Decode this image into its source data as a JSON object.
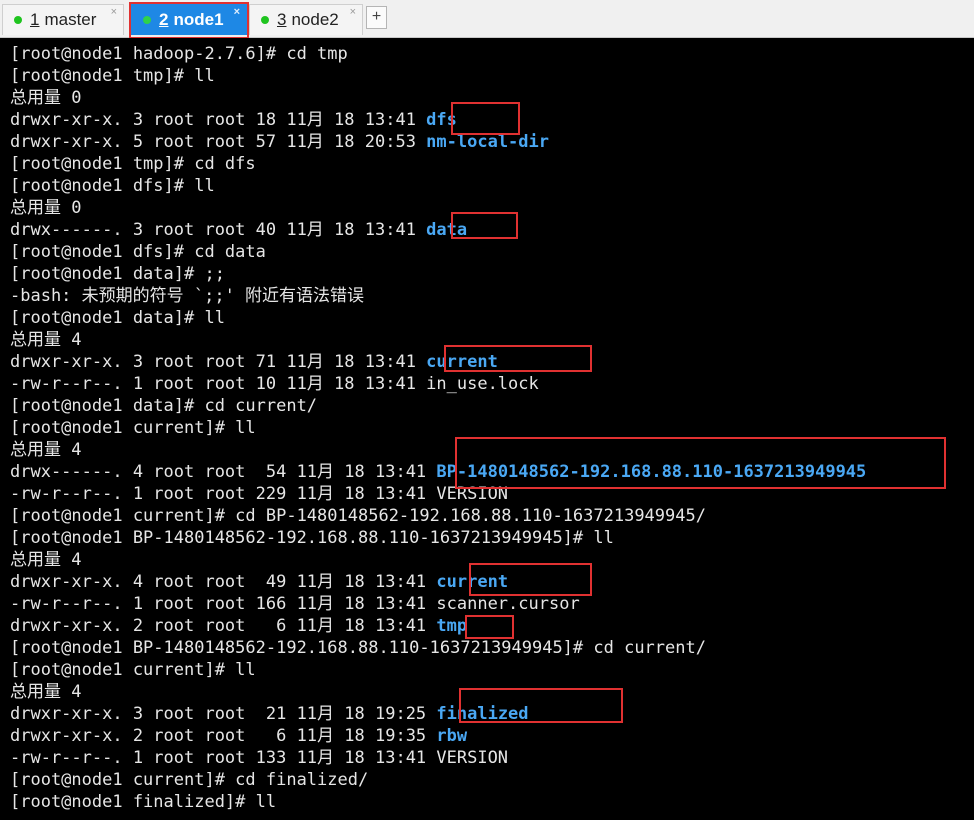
{
  "tabs": [
    {
      "number": "1",
      "name": "master",
      "active": false
    },
    {
      "number": "2",
      "name": "node1",
      "active": true
    },
    {
      "number": "3",
      "name": "node2",
      "active": false
    }
  ],
  "new_tab_symbol": "+",
  "close_symbol": "×",
  "colors": {
    "active_tab": "#1e88e5",
    "directory": "#4aa8f4",
    "highlight_box": "#e03131",
    "background": "#000000",
    "text": "#e6e6e6"
  },
  "terminal": {
    "lines": [
      {
        "text": "[root@node1 hadoop-2.7.6]# cd tmp"
      },
      {
        "text": "[root@node1 tmp]# ll"
      },
      {
        "text": "总用量 0"
      },
      {
        "text": "drwxr-xr-x. 3 root root 18 11月 18 13:41 ",
        "dir": "dfs"
      },
      {
        "text": "drwxr-xr-x. 5 root root 57 11月 18 20:53 ",
        "dir": "nm-local-dir"
      },
      {
        "text": "[root@node1 tmp]# cd dfs"
      },
      {
        "text": "[root@node1 dfs]# ll"
      },
      {
        "text": "总用量 0"
      },
      {
        "text": "drwx------. 3 root root 40 11月 18 13:41 ",
        "dir": "data"
      },
      {
        "text": "[root@node1 dfs]# cd data"
      },
      {
        "text": "[root@node1 data]# ;;"
      },
      {
        "text": "-bash: 未预期的符号 `;;' 附近有语法错误"
      },
      {
        "text": "[root@node1 data]# ll"
      },
      {
        "text": "总用量 4"
      },
      {
        "text": "drwxr-xr-x. 3 root root 71 11月 18 13:41 ",
        "dir": "current"
      },
      {
        "text": "-rw-r--r--. 1 root root 10 11月 18 13:41 in_use.lock"
      },
      {
        "text": "[root@node1 data]# cd current/"
      },
      {
        "text": "[root@node1 current]# ll"
      },
      {
        "text": "总用量 4"
      },
      {
        "text": "drwx------. 4 root root  54 11月 18 13:41 ",
        "dir": "BP-1480148562-192.168.88.110-1637213949945"
      },
      {
        "text": "-rw-r--r--. 1 root root 229 11月 18 13:41 VERSION"
      },
      {
        "text": "[root@node1 current]# cd BP-1480148562-192.168.88.110-1637213949945/"
      },
      {
        "text": "[root@node1 BP-1480148562-192.168.88.110-1637213949945]# ll"
      },
      {
        "text": "总用量 4"
      },
      {
        "text": "drwxr-xr-x. 4 root root  49 11月 18 13:41 ",
        "dir": "current"
      },
      {
        "text": "-rw-r--r--. 1 root root 166 11月 18 13:41 scanner.cursor"
      },
      {
        "text": "drwxr-xr-x. 2 root root   6 11月 18 13:41 ",
        "dir": "tmp"
      },
      {
        "text": "[root@node1 BP-1480148562-192.168.88.110-1637213949945]# cd current/"
      },
      {
        "text": "[root@node1 current]# ll"
      },
      {
        "text": "总用量 4"
      },
      {
        "text": "drwxr-xr-x. 3 root root  21 11月 18 19:25 ",
        "dir": "finalized"
      },
      {
        "text": "drwxr-xr-x. 2 root root   6 11月 18 19:35 ",
        "dir": "rbw"
      },
      {
        "text": "-rw-r--r--. 1 root root 133 11月 18 13:41 VERSION"
      },
      {
        "text": "[root@node1 current]# cd finalized/"
      },
      {
        "text": "[root@node1 finalized]# ll"
      }
    ]
  }
}
